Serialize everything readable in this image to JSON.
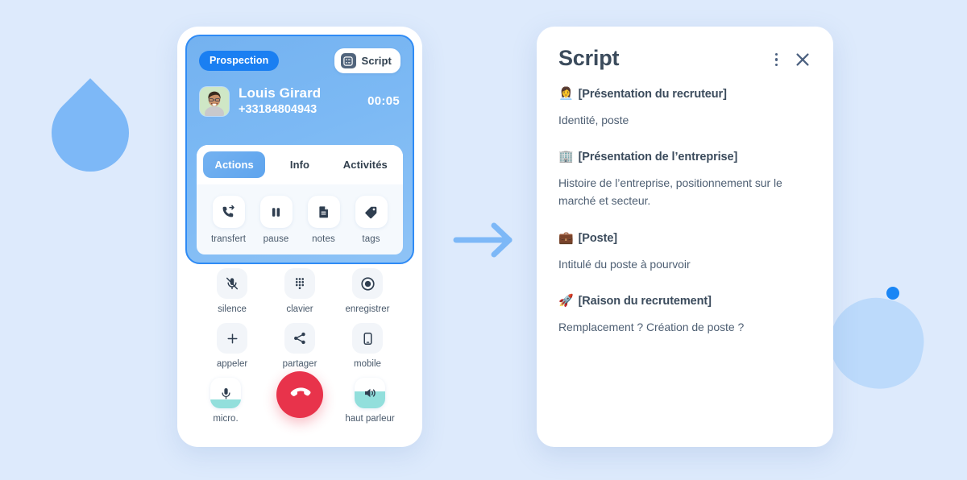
{
  "theme": {
    "page_bg": "#ddeafc",
    "accent_blue": "#1a7ff2",
    "panel_blue": "#7cb9f4",
    "hangup_red": "#e8334b",
    "level_teal": "#92dfdc",
    "text_slate": "#3b4b5c"
  },
  "call_panel": {
    "badge_label": "Prospection",
    "script_button_label": "Script",
    "contact_name": "Louis Girard",
    "contact_phone": "+33184804943",
    "timer": "00:05",
    "tabs": [
      {
        "label": "Actions",
        "active": true
      },
      {
        "label": "Info",
        "active": false
      },
      {
        "label": "Activités",
        "active": false
      }
    ],
    "actions": [
      {
        "label": "transfert",
        "icon": "call-transfer-icon"
      },
      {
        "label": "pause",
        "icon": "pause-icon"
      },
      {
        "label": "notes",
        "icon": "document-icon"
      },
      {
        "label": "tags",
        "icon": "tag-icon"
      }
    ],
    "controls_row_1": [
      {
        "label": "silence",
        "icon": "mic-muted-icon"
      },
      {
        "label": "clavier",
        "icon": "keypad-icon"
      },
      {
        "label": "enregistrer",
        "icon": "record-icon"
      }
    ],
    "controls_row_2": [
      {
        "label": "appeler",
        "icon": "plus-icon"
      },
      {
        "label": "partager",
        "icon": "share-icon"
      },
      {
        "label": "mobile",
        "icon": "smartphone-icon"
      }
    ],
    "controls_row_3": {
      "left": {
        "label": "micro.",
        "icon": "microphone-icon",
        "level_percent": 30
      },
      "hangup": {
        "label": "",
        "icon": "hangup-phone-icon"
      },
      "right": {
        "label": "haut parleur",
        "icon": "speaker-icon",
        "level_percent": 55
      }
    }
  },
  "script_panel": {
    "title": "Script",
    "menu_icon": "kebab-menu-icon",
    "close_icon": "close-icon",
    "sections": [
      {
        "emoji": "👩‍💼",
        "heading": "[Présentation du recruteur]",
        "text": "Identité, poste"
      },
      {
        "emoji": "🏢",
        "heading": "[Présentation de l’entreprise]",
        "text": "Histoire de l’entreprise, positionnement sur le marché et secteur."
      },
      {
        "emoji": "💼",
        "heading": "[Poste]",
        "text": "Intitulé du poste à pourvoir"
      },
      {
        "emoji": "🚀",
        "heading": "[Raison du recrutement]",
        "text": "Remplacement ? Création de poste ?"
      }
    ]
  },
  "decorations": {
    "arrow_icon": "arrow-right-icon",
    "left_shape": "half-circle-shape",
    "right_blob": "blob-shape",
    "right_dot": "dot-shape"
  }
}
